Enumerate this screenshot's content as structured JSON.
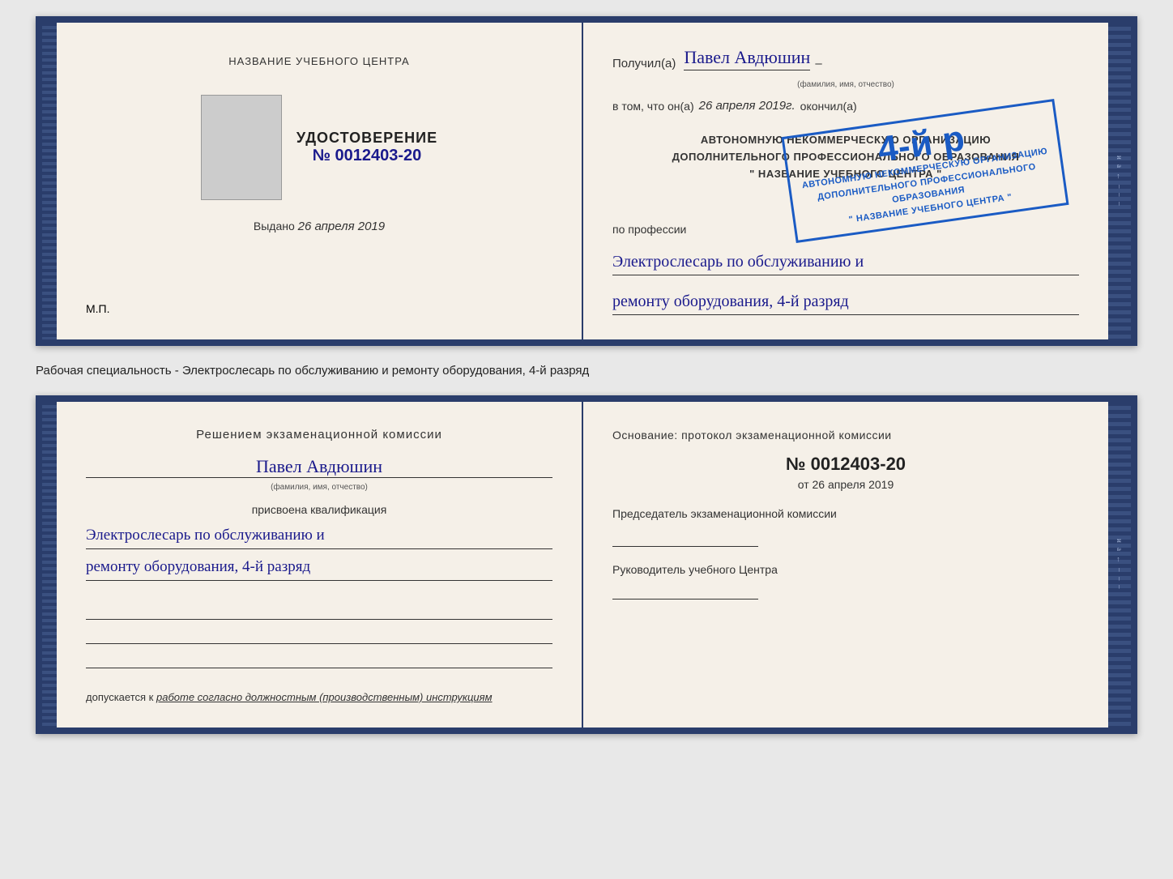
{
  "topDoc": {
    "left": {
      "title": "НАЗВАНИЕ УЧЕБНОГО ЦЕНТРА",
      "cert_title": "УДОСТОВЕРЕНИЕ",
      "cert_number_prefix": "№",
      "cert_number": "0012403-20",
      "vydano_label": "Выдано",
      "vydano_date": "26 апреля 2019",
      "mp_label": "М.П."
    },
    "right": {
      "poluchil_label": "Получил(а)",
      "name_handwritten": "Павел Авдюшин",
      "name_subtext": "(фамилия, имя, отчество)",
      "dash": "–",
      "vtom_label": "в том, что он(а)",
      "date_italic": "26 апреля 2019г.",
      "okonchil_label": "окончил(а)",
      "stamp_line1": "АВТОНОМНУЮ НЕКОММЕРЧЕСКУЮ ОРГАНИЗАЦИЮ",
      "stamp_line2": "ДОПОЛНИТЕЛЬНОГО ПРОФЕССИОНАЛЬНОГО ОБРАЗОВАНИЯ",
      "stamp_line3": "\" НАЗВАНИЕ УЧЕБНОГО ЦЕНТРА \"",
      "stamp_big": "4-й р",
      "po_professii_label": "по профессии",
      "profession_line1": "Электрослесарь по обслуживанию и",
      "profession_line2": "ремонту оборудования, 4-й разряд"
    }
  },
  "betweenText": "Рабочая специальность - Электрослесарь по обслуживанию и ремонту оборудования, 4-й разряд",
  "bottomDoc": {
    "left": {
      "resheniem_title": "Решением экзаменационной комиссии",
      "name_handwritten": "Павел Авдюшин",
      "name_subtext": "(фамилия, имя, отчество)",
      "prisvoena_label": "присвоена квалификация",
      "qual_line1": "Электрослесарь по обслуживанию и",
      "qual_line2": "ремонту оборудования, 4-й разряд",
      "dopuskaetsya_label": "допускается к",
      "dopusk_italic": "работе согласно должностным (производственным) инструкциям"
    },
    "right": {
      "osnovanie_label": "Основание: протокол экзаменационной комиссии",
      "number_prefix": "№",
      "number": "0012403-20",
      "ot_prefix": "от",
      "ot_date": "26 апреля 2019",
      "predsedatel_label": "Председатель экзаменационной комиссии",
      "rukovoditel_label": "Руководитель учебного Центра"
    }
  },
  "sideChars": [
    "и",
    "а",
    "←",
    "–",
    "–",
    "–",
    "–"
  ]
}
